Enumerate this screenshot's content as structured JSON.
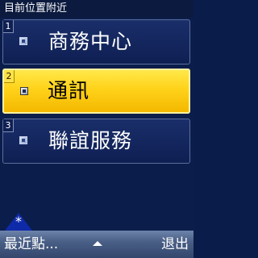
{
  "header": {
    "title": "目前位置附近"
  },
  "menu": {
    "items": [
      {
        "index": "1",
        "label": "商務中心",
        "selected": false
      },
      {
        "index": "2",
        "label": "通訊",
        "selected": true
      },
      {
        "index": "3",
        "label": "聯誼服務",
        "selected": false
      }
    ]
  },
  "softkeys": {
    "star": "*",
    "left": "最近點...",
    "right": "退出"
  },
  "colors": {
    "background": "#0b1d4b",
    "selected_highlight": "#ffd21a",
    "softkey_bar": "#4a5f86"
  },
  "icons": {
    "bullet": "square-bullet-icon",
    "star": "star-key-icon",
    "scroll": "up-arrow-icon"
  }
}
